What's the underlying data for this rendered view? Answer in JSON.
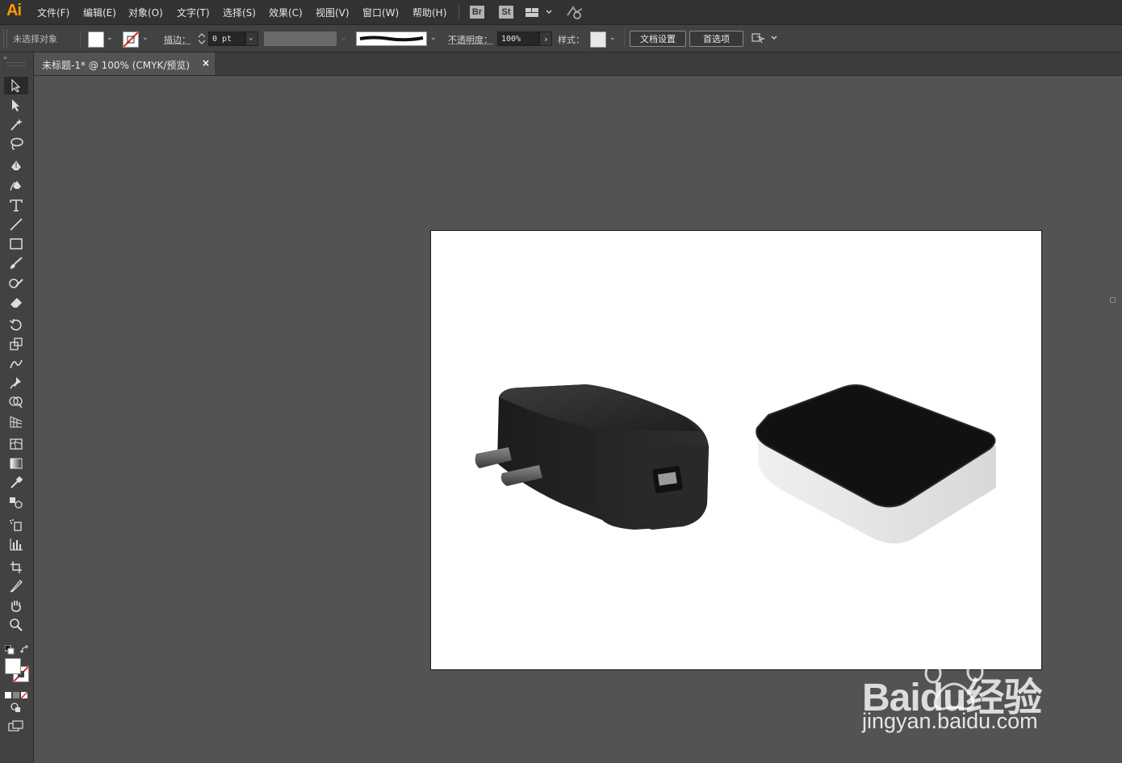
{
  "app": {
    "logo": "Ai"
  },
  "menu": [
    {
      "label": "文件(F)"
    },
    {
      "label": "编辑(E)"
    },
    {
      "label": "对象(O)"
    },
    {
      "label": "文字(T)"
    },
    {
      "label": "选择(S)"
    },
    {
      "label": "效果(C)"
    },
    {
      "label": "视图(V)"
    },
    {
      "label": "窗口(W)"
    },
    {
      "label": "帮助(H)"
    }
  ],
  "badges": {
    "bridge": "Br",
    "stock": "St"
  },
  "control": {
    "selection": "未选择对象",
    "stroke_label": "描边：",
    "stroke_value": "0 pt",
    "opacity_label": "不透明度：",
    "opacity_value": "100%",
    "style_label": "样式：",
    "doc_setup": "文档设置",
    "prefs": "首选项"
  },
  "document": {
    "tab_title": "未标题-1* @ 100% (CMYK/预览)",
    "close": "×"
  },
  "watermark": {
    "brand": "Baidu经验",
    "url": "jingyan.baidu.com"
  },
  "colors": {
    "accent": "#ff9a00",
    "canvas": "#535353",
    "panel": "#424242",
    "menubar": "#323232"
  }
}
